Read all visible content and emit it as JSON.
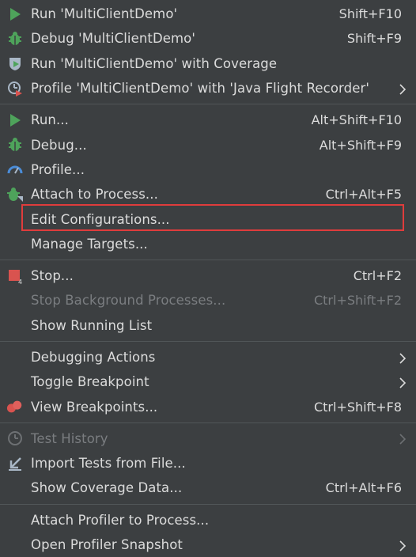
{
  "menu": {
    "groups": [
      {
        "items": [
          {
            "label": "Run 'MultiClientDemo'",
            "shortcut": "Shift+F10",
            "icon": "run-icon"
          },
          {
            "label": "Debug 'MultiClientDemo'",
            "shortcut": "Shift+F9",
            "icon": "debug-icon"
          },
          {
            "label": "Run 'MultiClientDemo' with Coverage",
            "shortcut": "",
            "icon": "coverage-icon"
          },
          {
            "label": "Profile 'MultiClientDemo' with 'Java Flight Recorder'",
            "shortcut": "",
            "icon": "profile-icon",
            "submenu": true
          }
        ]
      },
      {
        "items": [
          {
            "label": "Run...",
            "shortcut": "Alt+Shift+F10",
            "icon": "run-icon"
          },
          {
            "label": "Debug...",
            "shortcut": "Alt+Shift+F9",
            "icon": "debug-icon"
          },
          {
            "label": "Profile...",
            "shortcut": "",
            "icon": "gauge-icon"
          },
          {
            "label": "Attach to Process...",
            "shortcut": "Ctrl+Alt+F5",
            "icon": "attach-debug-icon"
          },
          {
            "label": "Edit Configurations...",
            "shortcut": "",
            "icon": "",
            "highlighted": true
          },
          {
            "label": "Manage Targets...",
            "shortcut": "",
            "icon": ""
          }
        ]
      },
      {
        "items": [
          {
            "label": "Stop...",
            "shortcut": "Ctrl+F2",
            "icon": "stop-icon"
          },
          {
            "label": "Stop Background Processes...",
            "shortcut": "Ctrl+Shift+F2",
            "icon": "",
            "disabled": true
          },
          {
            "label": "Show Running List",
            "shortcut": "",
            "icon": ""
          }
        ]
      },
      {
        "items": [
          {
            "label": "Debugging Actions",
            "shortcut": "",
            "icon": "",
            "submenu": true
          },
          {
            "label": "Toggle Breakpoint",
            "shortcut": "",
            "icon": "",
            "submenu": true
          },
          {
            "label": "View Breakpoints...",
            "shortcut": "Ctrl+Shift+F8",
            "icon": "breakpoints-icon"
          }
        ]
      },
      {
        "items": [
          {
            "label": "Test History",
            "shortcut": "",
            "icon": "history-icon",
            "submenu": true,
            "disabled": true
          },
          {
            "label": "Import Tests from File...",
            "shortcut": "",
            "icon": "import-icon"
          },
          {
            "label": "Show Coverage Data...",
            "shortcut": "Ctrl+Alt+F6",
            "icon": ""
          }
        ]
      },
      {
        "items": [
          {
            "label": "Attach Profiler to Process...",
            "shortcut": "",
            "icon": ""
          },
          {
            "label": "Open Profiler Snapshot",
            "shortcut": "",
            "icon": "",
            "submenu": true
          }
        ]
      }
    ]
  },
  "colors": {
    "background": "#3c3f41",
    "text": "#dcdcdc",
    "disabled_text": "#7a7d80",
    "separator": "#515658",
    "highlight_border": "#e03c3c",
    "run_green": "#4ea35b",
    "stop_red": "#d9534f"
  }
}
